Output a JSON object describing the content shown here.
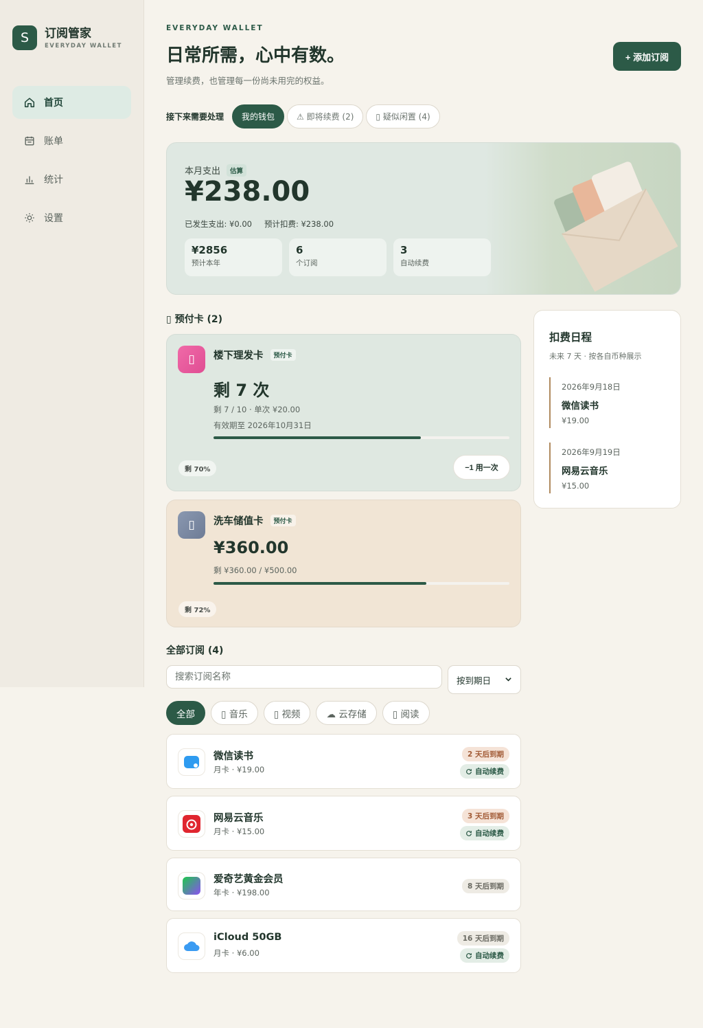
{
  "brand": {
    "logo": "S",
    "name": "订阅管家",
    "sub": "EVERYDAY WALLET"
  },
  "nav": [
    {
      "label": "首页",
      "icon": "home-icon"
    },
    {
      "label": "账单",
      "icon": "calendar-icon"
    },
    {
      "label": "统计",
      "icon": "chart-icon"
    },
    {
      "label": "设置",
      "icon": "gear-icon"
    }
  ],
  "header": {
    "eyebrow": "EVERYDAY WALLET",
    "title": "日常所需，心中有数。",
    "subtitle": "管理续费，也管理每一份尚未用完的权益。",
    "add_button": "+ 添加订阅"
  },
  "todo": {
    "label": "接下来需要处理",
    "pills": [
      "我的钱包",
      "⚠ 即将续费 (2)",
      "▯ 疑似闲置 (4)"
    ]
  },
  "spend": {
    "label": "本月支出",
    "tag": "估算",
    "amount": "¥238.00",
    "occurred": "已发生支出: ¥0.00",
    "expected": "预计扣费: ¥238.00",
    "stats": [
      {
        "value": "¥2856",
        "label": "预计本年"
      },
      {
        "value": "6",
        "label": "个订阅"
      },
      {
        "value": "3",
        "label": "自动续费"
      }
    ]
  },
  "prepaid": {
    "title": "▯ 预付卡 (2)",
    "cards": [
      {
        "name": "楼下理发卡",
        "tag": "预付卡",
        "icon_glyph": "▯",
        "big": "剩 7 次",
        "line1": "剩 7 / 10 · 单次 ¥20.00",
        "line2": "有效期至 2026年10月31日",
        "progress": 0.7,
        "pct": "剩 70%",
        "use_button": "−1 用一次"
      },
      {
        "name": "洗车储值卡",
        "tag": "预付卡",
        "icon_glyph": "▯",
        "big": "¥360.00",
        "line1": "剩 ¥360.00 / ¥500.00",
        "progress": 0.72,
        "pct": "剩 72%"
      }
    ]
  },
  "schedule": {
    "title": "扣费日程",
    "subtitle": "未来 7 天 · 按各自币种展示",
    "items": [
      {
        "date": "2026年9月18日",
        "name": "微信读书",
        "price": "¥19.00"
      },
      {
        "date": "2026年9月19日",
        "name": "网易云音乐",
        "price": "¥15.00"
      }
    ]
  },
  "subs": {
    "title": "全部订阅 (4)",
    "search_placeholder": "搜索订阅名称",
    "sort": "按到期日",
    "categories": [
      "全部",
      "▯ 音乐",
      "▯ 视频",
      "☁ 云存储",
      "▯ 阅读"
    ],
    "items": [
      {
        "name": "微信读书",
        "meta": "月卡 · ¥19.00",
        "due": "2 天后到期",
        "auto": "自动续费"
      },
      {
        "name": "网易云音乐",
        "meta": "月卡 · ¥15.00",
        "due": "3 天后到期",
        "auto": "自动续费"
      },
      {
        "name": "爱奇艺黄金会员",
        "meta": "年卡 · ¥198.00",
        "due": "8 天后到期",
        "auto": null
      },
      {
        "name": "iCloud 50GB",
        "meta": "月卡 · ¥6.00",
        "due": "16 天后到期",
        "auto": "自动续费"
      }
    ]
  }
}
